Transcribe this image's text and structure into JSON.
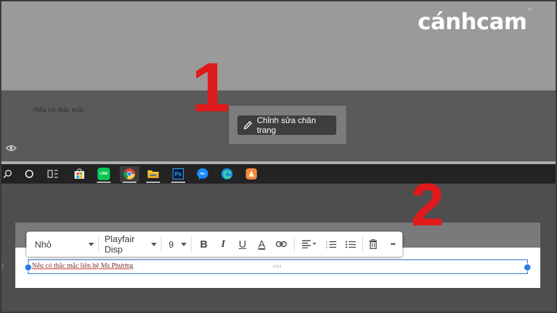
{
  "brand": {
    "logo_text": "cánhcam",
    "trademark": "™"
  },
  "footer": {
    "text": "Nếu có thắc mắc",
    "edit_button_label": "Chỉnh sửa chân trang"
  },
  "markers": {
    "step1": "1",
    "step2": "2"
  },
  "taskbar": {
    "icons": [
      "search-icon",
      "cortana-icon",
      "task-view-icon",
      "store-icon",
      "line-icon",
      "chrome-icon",
      "file-explorer-icon",
      "photoshop-icon",
      "messenger-icon",
      "edge-icon",
      "app-icon"
    ],
    "line_label": "LINE",
    "photoshop_label": "Ps"
  },
  "editor_toolbar": {
    "size_select": "Nhỏ",
    "font_select": "Playfair Disp",
    "font_size": "9",
    "bold_label": "B",
    "italic_label": "I",
    "underline_label": "U",
    "text_color_label": "A",
    "more_label": "•••"
  },
  "text_box": {
    "content": "Nếu có thắc mắc liên hệ Ms.Phương"
  },
  "colors": {
    "accent_red": "#e0191a",
    "selection_blue": "#2f6fd1",
    "toolbar_bg": "#ffffff"
  }
}
